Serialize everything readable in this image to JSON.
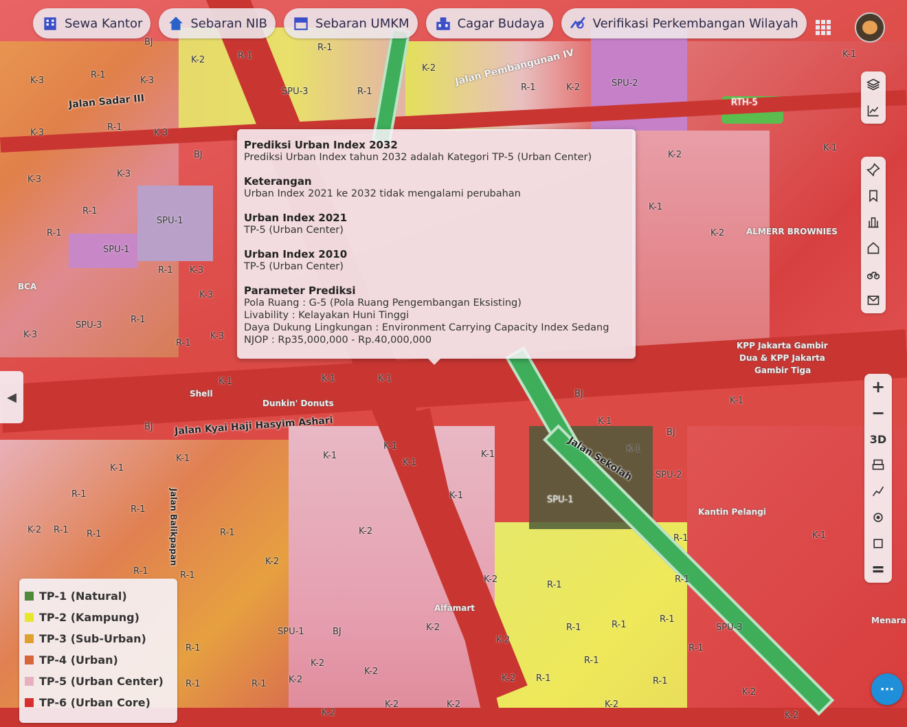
{
  "topbar": {
    "chips": [
      {
        "label": "Sewa Kantor",
        "icon": "building-icon"
      },
      {
        "label": "Sebaran NIB",
        "icon": "home-icon"
      },
      {
        "label": "Sebaran UMKM",
        "icon": "store-icon"
      },
      {
        "label": "Cagar Budaya",
        "icon": "heritage-icon"
      },
      {
        "label": "Verifikasi Perkembangan Wilayah",
        "icon": "trend-search-icon"
      }
    ]
  },
  "popup": {
    "sections": [
      {
        "heading": "Prediksi Urban Index 2032",
        "lines": [
          "Prediksi Urban Index tahun 2032 adalah Kategori TP-5 (Urban Center)"
        ]
      },
      {
        "heading": "Keterangan",
        "lines": [
          "Urban Index 2021 ke 2032 tidak mengalami perubahan"
        ]
      },
      {
        "heading": "Urban Index 2021",
        "lines": [
          "TP-5 (Urban Center)"
        ]
      },
      {
        "heading": "Urban Index 2010",
        "lines": [
          "TP-5 (Urban Center)"
        ]
      },
      {
        "heading": "Parameter Prediksi",
        "lines": [
          "Pola Ruang : G-5 (Pola Ruang Pengembangan Eksisting)",
          "Livability : Kelayakan Huni Tinggi",
          "Daya Dukung Lingkungan : Environment Carrying Capacity Index Sedang",
          "NJOP : Rp35,000,000 - Rp.40,000,000"
        ]
      }
    ]
  },
  "legend": {
    "items": [
      {
        "label": "TP-1 (Natural)",
        "color": "#4f8a3a"
      },
      {
        "label": "TP-2 (Kampung)",
        "color": "#e6e62e"
      },
      {
        "label": "TP-3 (Sub-Urban)",
        "color": "#e0a030"
      },
      {
        "label": "TP-4 (Urban)",
        "color": "#d8663a"
      },
      {
        "label": "TP-5 (Urban Center)",
        "color": "#e6b0c0"
      },
      {
        "label": "TP-6 (Urban Core)",
        "color": "#d8302e"
      }
    ]
  },
  "map": {
    "streets": {
      "hasyim": "Jalan Kyai Haji Hasyim Ashari",
      "sekolah": "Jalan Sekolah",
      "pembangunan": "Jalan Pembangunan IV",
      "sadar": "Jalan Sadar III",
      "balikpapan": "Jalan Balikpapan"
    },
    "pois": {
      "shell": "Shell",
      "dunkin": "Dunkin' Donuts",
      "alfamart": "Alfamart",
      "almerr": "ALMERR BROWNIES",
      "kpp": "KPP Jakarta Gambir",
      "kpp2": "Dua & KPP Jakarta",
      "kpp3": "Gambir Tiga",
      "kantin": "Kantin Pelangi",
      "bca": "BCA",
      "menara": "Menara"
    },
    "zones": [
      "R-1",
      "K-1",
      "K-2",
      "K-3",
      "SPU-1",
      "SPU-2",
      "SPU-3",
      "RTH-5",
      "BJ"
    ]
  },
  "right_tools": {
    "zoom_in": "+",
    "zoom_out": "−",
    "three_d": "3D"
  },
  "chat": {
    "label": "···"
  }
}
